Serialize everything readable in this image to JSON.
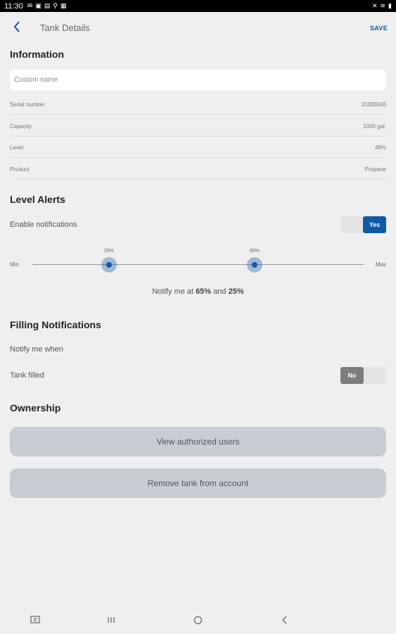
{
  "status_bar": {
    "time": "11:30",
    "left_icons": [
      "mail-icon",
      "image-icon",
      "gallery-icon",
      "location-icon",
      "calendar-icon"
    ],
    "right_icons": [
      "mute-icon",
      "wifi-icon",
      "battery-icon"
    ]
  },
  "header": {
    "back_icon": "chevron-left-icon",
    "title": "Tank Details",
    "save_label": "SAVE"
  },
  "information": {
    "heading": "Information",
    "custom_name_placeholder": "Custom name",
    "rows": [
      {
        "label": "Serial number",
        "value": "20285506"
      },
      {
        "label": "Capacity",
        "value": "1000 gal."
      },
      {
        "label": "Level",
        "value": "48%"
      },
      {
        "label": "Product",
        "value": "Propane"
      }
    ]
  },
  "level_alerts": {
    "heading": "Level Alerts",
    "enable_label": "Enable notifications",
    "enable_toggle": "Yes",
    "slider_min": "Min",
    "slider_max": "Max",
    "low_label": "25%",
    "high_label": "65%",
    "low_value": 25,
    "high_value": 65,
    "notify_prefix": "Notify me at ",
    "notify_high": "65%",
    "notify_and": " and ",
    "notify_low": "25%"
  },
  "filling": {
    "heading": "Filling Notifications",
    "notify_when": "Notify me when",
    "tank_filled": "Tank filled",
    "tank_filled_toggle": "No"
  },
  "ownership": {
    "heading": "Ownership",
    "view_users": "View authorized users",
    "remove_tank": "Remove tank from account"
  },
  "nav": {
    "icons": [
      "screenshot-icon",
      "recent-apps-icon",
      "home-icon",
      "back-icon"
    ]
  },
  "colors": {
    "accent": "#0f5aa6",
    "background": "#efefef",
    "button": "#c8ccd3"
  }
}
